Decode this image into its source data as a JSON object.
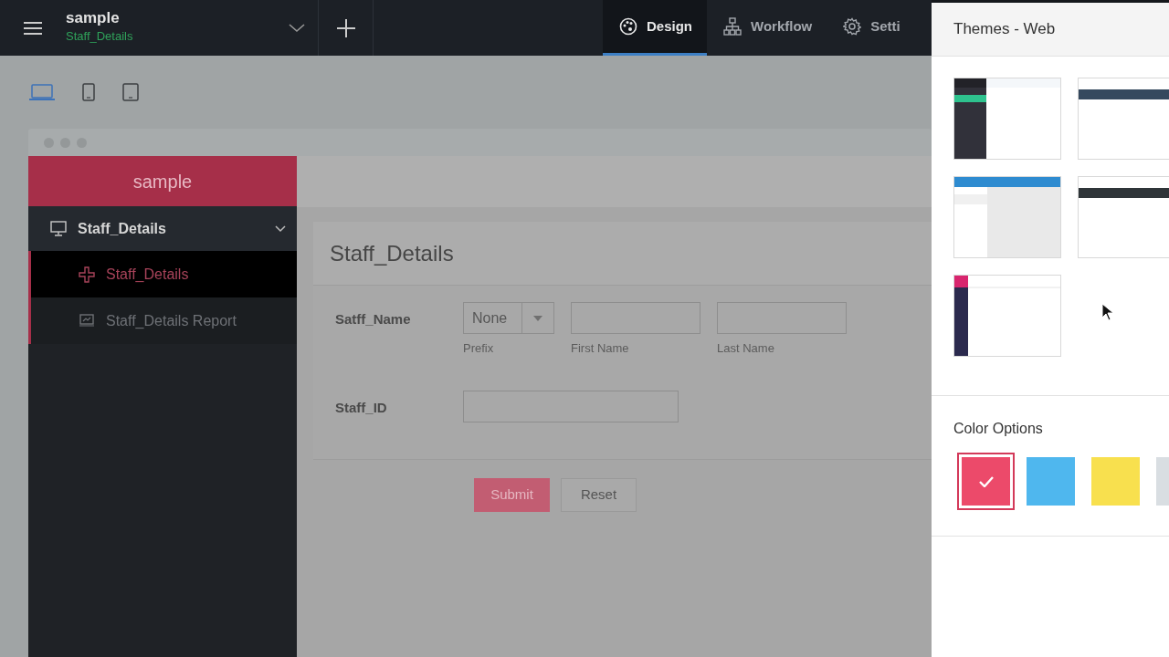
{
  "top_bar": {
    "app_name": "sample",
    "form_name": "Staff_Details",
    "tabs": [
      {
        "label": "Design",
        "kind": "palette",
        "selected": true
      },
      {
        "label": "Workflow",
        "kind": "workflow",
        "selected": false
      },
      {
        "label": "Setti",
        "kind": "gear",
        "selected": false
      }
    ]
  },
  "devices": [
    {
      "kind": "laptop",
      "selected": true
    },
    {
      "kind": "phone",
      "selected": false
    },
    {
      "kind": "tablet",
      "selected": false
    }
  ],
  "preview": {
    "app_title": "sample",
    "sidebar": {
      "items": [
        {
          "label": "Staff_Details",
          "kind": "section",
          "expanded": true,
          "children": [
            {
              "label": "Staff_Details",
              "kind": "form",
              "selected": true
            },
            {
              "label": "Staff_Details Report",
              "kind": "report",
              "selected": false
            }
          ]
        }
      ]
    },
    "form": {
      "title": "Staff_Details",
      "fields": [
        {
          "label": "Satff_Name",
          "kind": "name",
          "parts": [
            {
              "kind": "select",
              "value": "None",
              "caption": "Prefix"
            },
            {
              "kind": "text",
              "caption": "First Name"
            },
            {
              "kind": "text",
              "caption": "Last Name"
            }
          ]
        },
        {
          "label": "Staff_ID",
          "kind": "text"
        }
      ],
      "buttons": [
        {
          "label": "Submit",
          "kind": "primary"
        },
        {
          "label": "Reset",
          "kind": "secondary"
        }
      ]
    }
  },
  "themes_panel": {
    "title": "Themes - Web",
    "themes": [
      {
        "kind": "sidebar",
        "color": "#2ec28e"
      },
      {
        "kind": "topbar",
        "color": "#35495e"
      },
      {
        "kind": "split",
        "color": "#2e8bd0"
      },
      {
        "kind": "topbar",
        "color": "#2f3539"
      },
      {
        "kind": "sidebar-navy",
        "color": "#d8256e"
      }
    ],
    "color_options_title": "Color Options",
    "colors": [
      {
        "color": "#ec4a6a",
        "selected": true
      },
      {
        "color": "#4fb7ee",
        "selected": false
      },
      {
        "color": "#f8e04e",
        "selected": false
      },
      {
        "color": "#d9dee2",
        "selected": false
      }
    ]
  }
}
